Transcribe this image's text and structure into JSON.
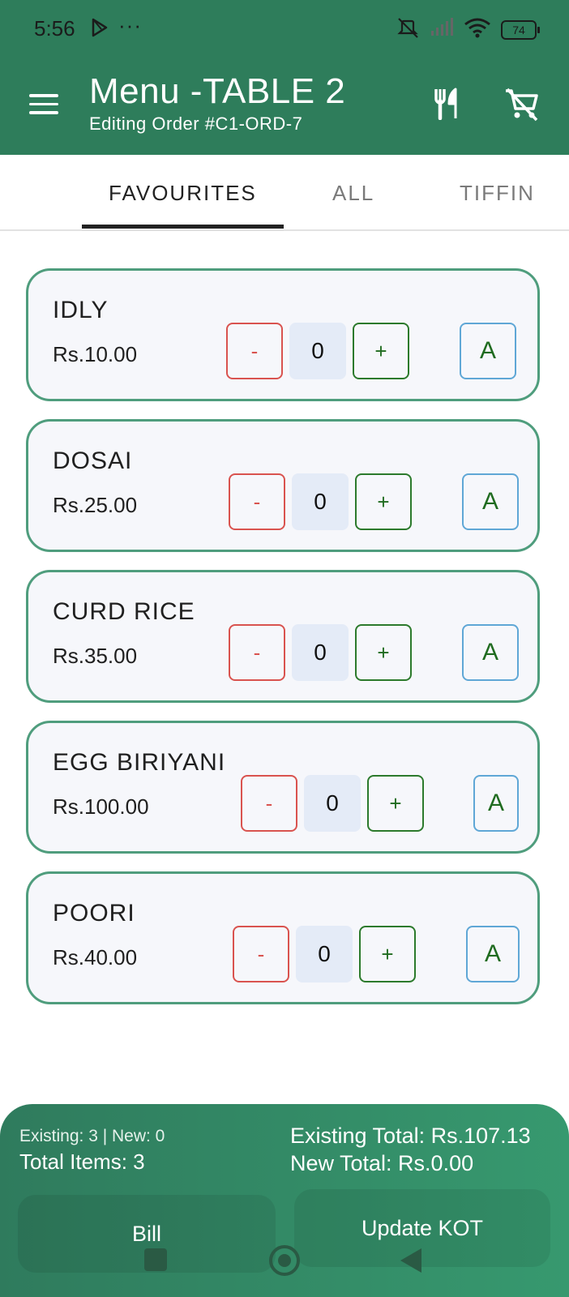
{
  "status_bar": {
    "time": "5:56",
    "overflow": "···",
    "battery": "74",
    "icons": [
      "play-store-icon",
      "mute-vibrate-icon",
      "signal-icon",
      "wifi-icon",
      "battery-icon"
    ]
  },
  "header": {
    "title": "Menu -TABLE 2",
    "subtitle": "Editing Order #C1-ORD-7",
    "icons": [
      "menu-icon",
      "cutlery-icon",
      "cart-off-icon"
    ],
    "background": "#2e7d5b"
  },
  "tabs": [
    {
      "label": "FAVOURITES",
      "active": true
    },
    {
      "label": "ALL",
      "active": false
    },
    {
      "label": "TIFFIN",
      "active": false
    }
  ],
  "items": [
    {
      "name": "IDLY",
      "price": "Rs.10.00",
      "minus": "-",
      "qty": "0",
      "plus": "+",
      "addon": "A"
    },
    {
      "name": "DOSAI",
      "price": "Rs.25.00",
      "minus": "-",
      "qty": "0",
      "plus": "+",
      "addon": "A"
    },
    {
      "name": "CURD RICE",
      "price": "Rs.35.00",
      "minus": "-",
      "qty": "0",
      "plus": "+",
      "addon": "A"
    },
    {
      "name": "EGG BIRIYANI",
      "price": "Rs.100.00",
      "minus": "-",
      "qty": "0",
      "plus": "+",
      "addon": "A"
    },
    {
      "name": "POORI",
      "price": "Rs.40.00",
      "minus": "-",
      "qty": "0",
      "plus": "+",
      "addon": "A"
    }
  ],
  "summary": {
    "counts": "Existing: 3 | New: 0",
    "total_items": "Total Items: 3",
    "existing_total": "Existing Total: Rs.107.13",
    "new_total": "New Total: Rs.0.00",
    "bill_label": "Bill",
    "update_label": "Update KOT"
  },
  "colors": {
    "primary": "#2e7d5b",
    "card_border": "#4f9d7d",
    "minus": "#d9534f",
    "plus": "#1f6b1f",
    "addon_border": "#5fa7d6"
  }
}
